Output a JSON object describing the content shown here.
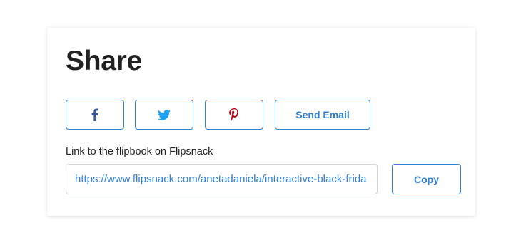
{
  "share": {
    "title": "Share",
    "buttons": {
      "facebook_icon": "facebook-icon",
      "twitter_icon": "twitter-icon",
      "pinterest_icon": "pinterest-icon",
      "send_email_label": "Send Email"
    },
    "link_label": "Link to the flipbook on Flipsnack",
    "link_value": "https://www.flipsnack.com/anetadaniela/interactive-black-frida",
    "copy_label": "Copy"
  },
  "colors": {
    "accent": "#2f80d8",
    "facebook": "#3b5998",
    "twitter": "#1da1f2",
    "pinterest": "#bd081c",
    "title_text": "#212121",
    "input_border": "#cfd4da"
  }
}
